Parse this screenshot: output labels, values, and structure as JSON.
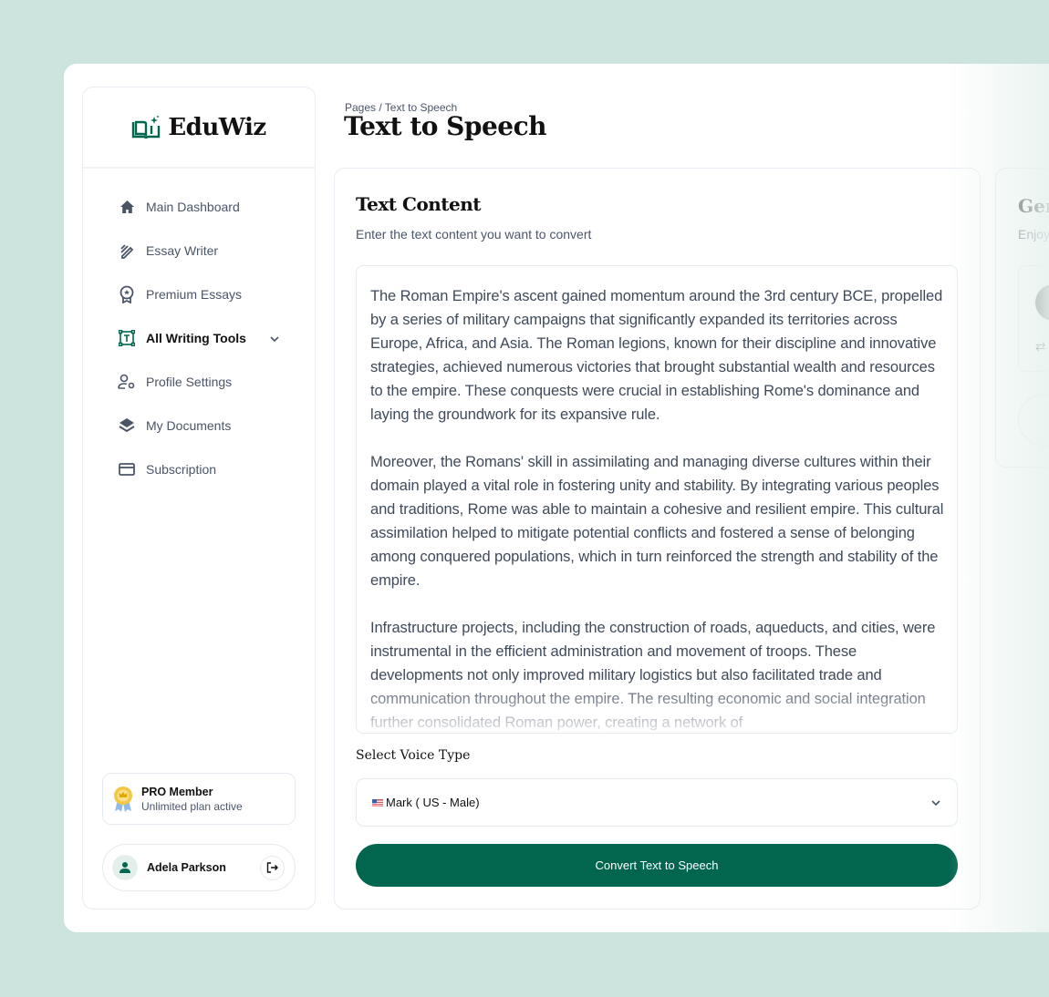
{
  "brand": {
    "name": "EduWiz",
    "accent": "#02664f"
  },
  "sidebar": {
    "items": [
      {
        "label": "Main Dashboard",
        "icon": "home-icon"
      },
      {
        "label": "Essay Writer",
        "icon": "pencil-icon"
      },
      {
        "label": "Premium Essays",
        "icon": "award-icon"
      },
      {
        "label": "All Writing Tools",
        "icon": "text-frame-icon",
        "active": true
      },
      {
        "label": "Profile Settings",
        "icon": "user-gear-icon"
      },
      {
        "label": "My Documents",
        "icon": "layers-icon"
      },
      {
        "label": "Subscription",
        "icon": "credit-card-icon"
      }
    ],
    "pro": {
      "title": "PRO Member",
      "subtitle": "Unlimited plan active"
    },
    "user": {
      "name": "Adela Parkson"
    }
  },
  "header": {
    "breadcrumb": "Pages / Text to Speech",
    "title": "Text to Speech"
  },
  "main": {
    "title": "Text Content",
    "subtitle": "Enter the text content you want to convert",
    "paragraphs": [
      "The Roman Empire's ascent gained momentum around the 3rd century BCE, propelled by a series of military campaigns that significantly expanded its territories across Europe, Africa, and Asia. The Roman legions, known for their discipline and innovative strategies, achieved numerous victories that brought substantial wealth and resources to the empire. These conquests were crucial in establishing Rome's dominance and laying the groundwork for its expansive rule.",
      "Moreover, the Romans' skill in assimilating and managing diverse cultures within their domain played a vital role in fostering unity and stability. By integrating various peoples and traditions, Rome was able to maintain a cohesive and resilient empire. This cultural assimilation helped to mitigate potential conflicts and fostered a sense of belonging among conquered populations, which in turn reinforced the strength and stability of the empire.",
      "Infrastructure projects, including the construction of roads, aqueducts, and cities, were instrumental in the efficient administration and movement of troops. These developments not only improved military logistics but also facilitated trade and communication throughout the empire. The resulting economic and social integration further consolidated Roman power, creating a network of"
    ],
    "voice_label": "Select Voice Type",
    "voice_selected": "Mark ( US - Male)",
    "convert_label": "Convert Text to Speech"
  },
  "right_panel": {
    "title": "Gen",
    "subtitle": "Enjoy"
  }
}
